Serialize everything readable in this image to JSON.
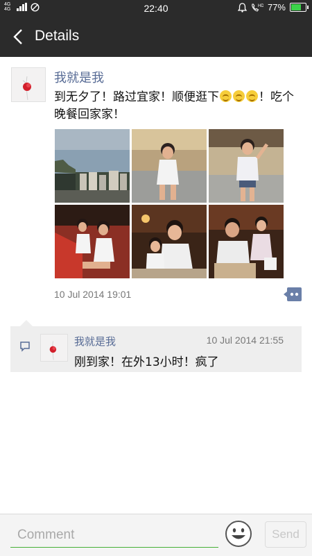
{
  "status_bar": {
    "network": "4G 4G",
    "time": "22:40",
    "battery": "77%",
    "battery_level": 0.77,
    "icons": [
      "signal-icon",
      "no-disturb-icon",
      "alarm-icon",
      "hd-call-icon",
      "battery-icon"
    ]
  },
  "header": {
    "title": "Details",
    "back_icon": "back-arrow-icon"
  },
  "post": {
    "author": "我就是我",
    "text_before_emoji": "到无夕了！路过宜家！顺便逛下",
    "text_after_emoji": "！吃个晚餐回家家！",
    "emoji_count": 3,
    "timestamp": "10 Jul 2014 19:01",
    "photo_count": 6,
    "more_icon": "more-actions-icon"
  },
  "comments": [
    {
      "author": "我就是我",
      "time": "10 Jul 2014 21:55",
      "text": "刚到家！在外13小时！疯了"
    }
  ],
  "footer": {
    "placeholder": "Comment",
    "send_label": "Send",
    "accent_color": "#45b035"
  }
}
